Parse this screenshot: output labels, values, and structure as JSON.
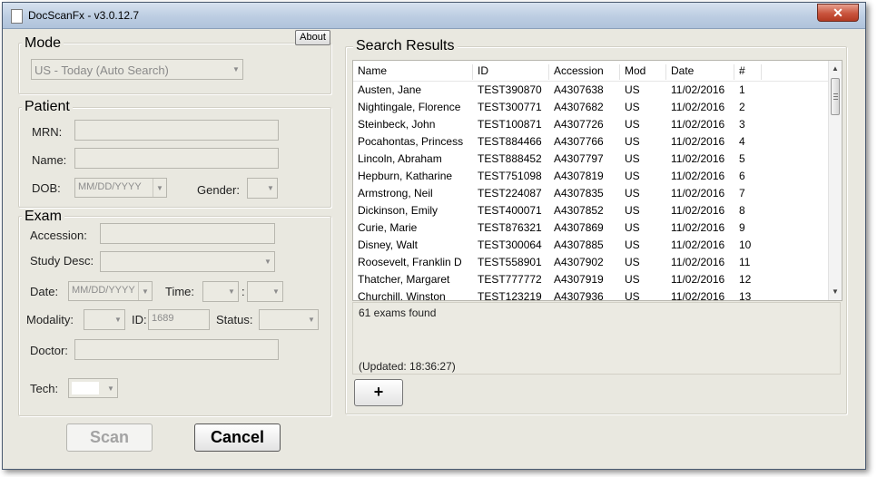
{
  "window": {
    "title": "DocScanFx  -  v3.0.12.7",
    "close_glyph": "✕"
  },
  "mode": {
    "legend": "Mode",
    "about_label": "About",
    "dropdown_value": "US - Today (Auto Search)"
  },
  "patient": {
    "legend": "Patient",
    "mrn_label": "MRN:",
    "name_label": "Name:",
    "dob_label": "DOB:",
    "dob_placeholder": "MM/DD/YYYY",
    "gender_label": "Gender:"
  },
  "exam": {
    "legend": "Exam",
    "accession_label": "Accession:",
    "study_desc_label": "Study Desc:",
    "date_label": "Date:",
    "date_placeholder": "MM/DD/YYYY",
    "time_label": "Time:",
    "time_sep": ":",
    "modality_label": "Modality:",
    "id_label": "ID:",
    "id_value": "1689",
    "status_label": "Status:",
    "doctor_label": "Doctor:",
    "tech_label": "Tech:"
  },
  "buttons": {
    "scan": "Scan",
    "cancel": "Cancel",
    "add": "+"
  },
  "results": {
    "legend": "Search Results",
    "columns": [
      "Name",
      "ID",
      "Accession",
      "Mod",
      "Date",
      "#"
    ],
    "rows": [
      [
        "Austen, Jane",
        "TEST390870",
        "A4307638",
        "US",
        "11/02/2016",
        "1"
      ],
      [
        "Nightingale, Florence",
        "TEST300771",
        "A4307682",
        "US",
        "11/02/2016",
        "2"
      ],
      [
        "Steinbeck, John",
        "TEST100871",
        "A4307726",
        "US",
        "11/02/2016",
        "3"
      ],
      [
        "Pocahontas, Princess",
        "TEST884466",
        "A4307766",
        "US",
        "11/02/2016",
        "4"
      ],
      [
        "Lincoln, Abraham",
        "TEST888452",
        "A4307797",
        "US",
        "11/02/2016",
        "5"
      ],
      [
        "Hepburn, Katharine",
        "TEST751098",
        "A4307819",
        "US",
        "11/02/2016",
        "6"
      ],
      [
        "Armstrong, Neil",
        "TEST224087",
        "A4307835",
        "US",
        "11/02/2016",
        "7"
      ],
      [
        "Dickinson, Emily",
        "TEST400071",
        "A4307852",
        "US",
        "11/02/2016",
        "8"
      ],
      [
        "Curie, Marie",
        "TEST876321",
        "A4307869",
        "US",
        "11/02/2016",
        "9"
      ],
      [
        "Disney, Walt",
        "TEST300064",
        "A4307885",
        "US",
        "11/02/2016",
        "10"
      ],
      [
        "Roosevelt, Franklin D",
        "TEST558901",
        "A4307902",
        "US",
        "11/02/2016",
        "11"
      ],
      [
        "Thatcher, Margaret",
        "TEST777772",
        "A4307919",
        "US",
        "11/02/2016",
        "12"
      ],
      [
        "Churchill, Winston",
        "TEST123219",
        "A4307936",
        "US",
        "11/02/2016",
        "13"
      ]
    ],
    "found_text": "61 exams found",
    "updated_text": "(Updated: 18:36:27)"
  },
  "icons": {
    "dropdown": "chevron-down-icon",
    "scroll_up": "scroll-up-arrow",
    "scroll_down": "scroll-down-arrow"
  }
}
